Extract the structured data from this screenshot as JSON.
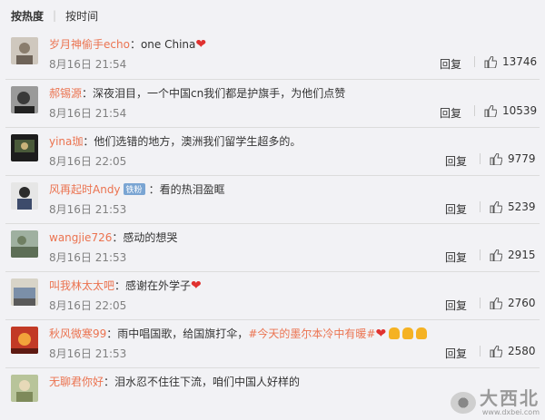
{
  "tabs": {
    "hot": "按热度",
    "time": "按时间"
  },
  "comments": [
    {
      "user": "岁月神偷手echo",
      "text": "one China",
      "date": "8月16日 21:54",
      "reply": "回复",
      "likes": "13746",
      "suffix_icon": "heart-icon"
    },
    {
      "user": "郝锡源",
      "text": "深夜泪目，一个中国cn我们都是护旗手，为他们点赞",
      "date": "8月16日 21:54",
      "reply": "回复",
      "likes": "10539"
    },
    {
      "user": "yina珈",
      "text": "他们选错的地方，澳洲我们留学生超多的。",
      "date": "8月16日 22:05",
      "reply": "回复",
      "likes": "9779"
    },
    {
      "user": "风再起时Andy",
      "badge": "铁粉",
      "text": "看的热泪盈眶",
      "date": "8月16日 21:53",
      "reply": "回复",
      "likes": "5239"
    },
    {
      "user": "wangjie726",
      "text": "感动的想哭",
      "date": "8月16日 21:53",
      "reply": "回复",
      "likes": "2915"
    },
    {
      "user": "叫我林太太吧",
      "text": "感谢在外学子",
      "date": "8月16日 22:05",
      "reply": "回复",
      "likes": "2760",
      "suffix_icon": "heart-icon"
    },
    {
      "user": "秋风微寒99",
      "text": "雨中唱国歌，给国旗打伞，",
      "hashtag": "#今天的墨尔本冷中有暖#",
      "date": "8月16日 21:53",
      "reply": "回复",
      "likes": "2580",
      "suffix_icon": "heart-and-thumbs-up-icons"
    },
    {
      "user": "无聊君你好",
      "text": "泪水忍不住往下流，咱们中国人好样的",
      "date": "",
      "reply": "",
      "likes": ""
    }
  ],
  "watermark": {
    "main": "大西北",
    "url": "www.dxbei.com"
  },
  "colors": {
    "username": "#eb7350",
    "date": "#808080",
    "heart": "#e0312f"
  }
}
